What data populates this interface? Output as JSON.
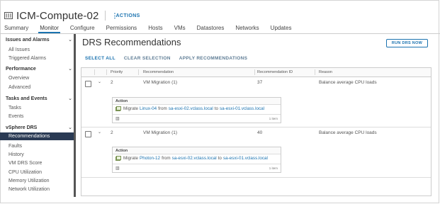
{
  "header": {
    "title": "ICM-Compute-02",
    "actions_label": "ACTIONS",
    "host_icon": "host-icon"
  },
  "tabs": [
    {
      "label": "Summary"
    },
    {
      "label": "Monitor",
      "active": true
    },
    {
      "label": "Configure"
    },
    {
      "label": "Permissions"
    },
    {
      "label": "Hosts"
    },
    {
      "label": "VMs"
    },
    {
      "label": "Datastores"
    },
    {
      "label": "Networks"
    },
    {
      "label": "Updates"
    }
  ],
  "sidebar": {
    "sections": [
      {
        "label": "Issues and Alarms",
        "items": [
          "All Issues",
          "Triggered Alarms"
        ]
      },
      {
        "label": "Performance",
        "items": [
          "Overview",
          "Advanced"
        ]
      },
      {
        "label": "Tasks and Events",
        "items": [
          "Tasks",
          "Events"
        ]
      },
      {
        "label": "vSphere DRS",
        "items": [
          "Recommendations",
          "Faults",
          "History",
          "VM DRS Score",
          "CPU Utilization",
          "Memory Utilization",
          "Network Utilization"
        ]
      }
    ],
    "active_item": "Recommendations"
  },
  "main": {
    "title": "DRS Recommendations",
    "run_button": "RUN DRS NOW",
    "toolbar": {
      "select_all": "SELECT ALL",
      "clear_selection": "CLEAR SELECTION",
      "apply": "APPLY RECOMMENDATIONS"
    },
    "columns": [
      "Priority",
      "Recommendation",
      "Recommendation ID",
      "Reason"
    ],
    "rows": [
      {
        "priority": "2",
        "recommendation": "VM Migration (1)",
        "id": "37",
        "reason": "Balance average CPU loads",
        "action_header": "Action",
        "action": {
          "verb": "Migrate",
          "vm": "Linux-04",
          "from_word": "from",
          "from_host": "sa-esxi-02.vclass.local",
          "to_word": "to",
          "to_host": "sa-esxi-01.vclass.local"
        },
        "count": "1 item"
      },
      {
        "priority": "2",
        "recommendation": "VM Migration (1)",
        "id": "40",
        "reason": "Balance average CPU loads",
        "action_header": "Action",
        "action": {
          "verb": "Migrate",
          "vm": "Photon-12",
          "from_word": "from",
          "from_host": "sa-esxi-02.vclass.local",
          "to_word": "to",
          "to_host": "sa-esxi-01.vclass.local"
        },
        "count": "1 item"
      }
    ]
  },
  "colors": {
    "accent": "#1b73b0",
    "active_nav_bg": "#2a3a54"
  }
}
